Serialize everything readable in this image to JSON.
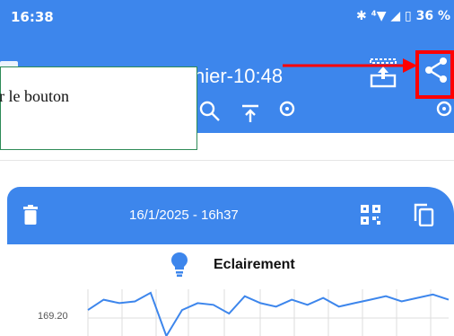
{
  "status_bar": {
    "time": "16:38",
    "icons_text": "✱ ⁴▼ ◢ ▯",
    "battery": "36 %"
  },
  "header": {
    "title": "hier-10:48",
    "upload_icon": "upload-icon",
    "share_icon": "share-icon"
  },
  "tooltip": {
    "text": "r le bouton"
  },
  "card": {
    "datetime": "16/1/2025 - 16h37",
    "chart_title": "Eclairement"
  },
  "chart_data": {
    "type": "line",
    "title": "Eclairement",
    "yticks": [
      "169.20"
    ],
    "series": [
      {
        "values": [
          169.2,
          169.26,
          169.24,
          169.25,
          169.3,
          169.05,
          169.2,
          169.24,
          169.23,
          169.18,
          169.28,
          169.24,
          169.22,
          169.26,
          169.23,
          169.27,
          169.22,
          169.24,
          169.26,
          169.28,
          169.25,
          169.27,
          169.29,
          169.26
        ]
      }
    ],
    "ylim": [
      169.05,
      169.32
    ],
    "grid": true,
    "line_color": "#3d86ec"
  },
  "colors": {
    "primary": "#3d86ec",
    "highlight": "#ff0000",
    "tooltip_border": "#2e8b57"
  }
}
